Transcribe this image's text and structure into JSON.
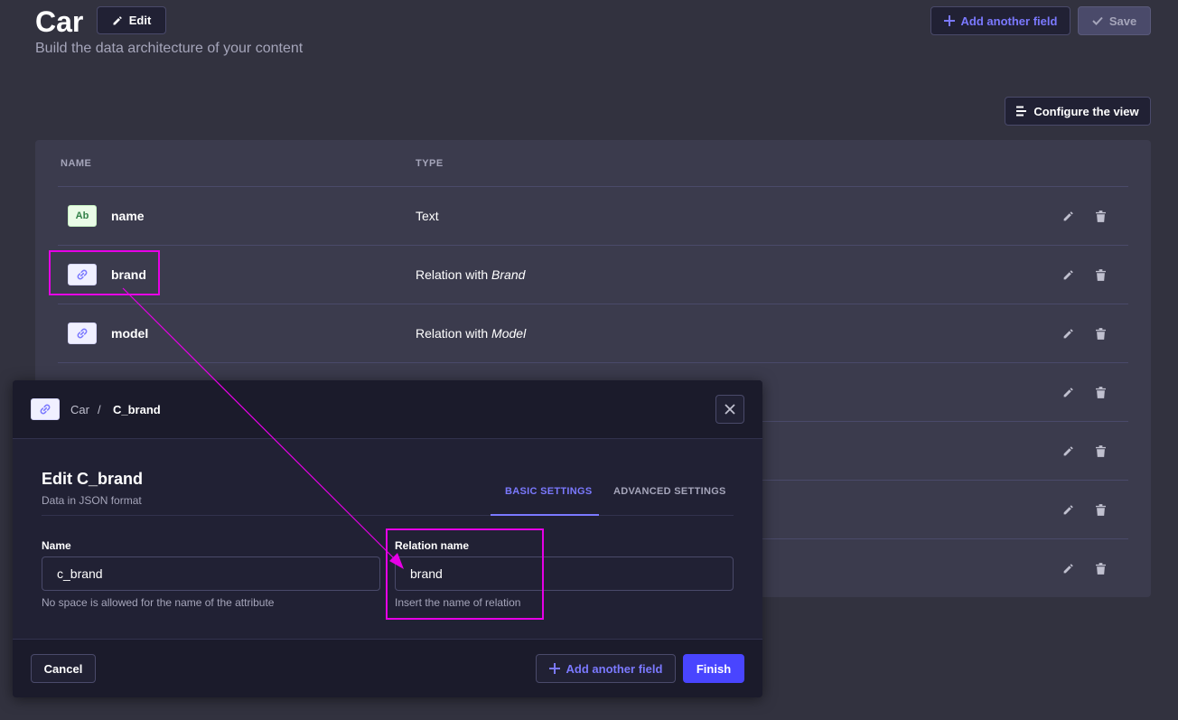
{
  "header": {
    "title": "Car",
    "subtitle": "Build the data architecture of your content",
    "edit_label": "Edit",
    "add_field_label": "Add another field",
    "save_label": "Save",
    "configure_label": "Configure the view"
  },
  "table": {
    "columns": [
      "NAME",
      "TYPE"
    ],
    "rows": [
      {
        "icon": "Ab",
        "name": "name",
        "type_prefix": "Text",
        "type_target": ""
      },
      {
        "icon": "relation",
        "name": "brand",
        "type_prefix": "Relation with",
        "type_target": "Brand"
      },
      {
        "icon": "relation",
        "name": "model",
        "type_prefix": "Relation with",
        "type_target": "Model"
      }
    ]
  },
  "modal": {
    "breadcrumb_parent": "Car",
    "breadcrumb_sep": "/",
    "breadcrumb_current": "C_brand",
    "title": "Edit C_brand",
    "subtitle": "Data in JSON format",
    "tabs": [
      "BASIC SETTINGS",
      "ADVANCED SETTINGS"
    ],
    "name_label": "Name",
    "name_value": "c_brand",
    "name_hint": "No space is allowed for the name of the attribute",
    "relation_label": "Relation name",
    "relation_value": "brand",
    "relation_hint": "Insert the name of relation",
    "cancel_label": "Cancel",
    "add_field_label": "Add another field",
    "finish_label": "Finish"
  },
  "colors": {
    "accent": "#7b79ff",
    "primary": "#4945ff",
    "annotation": "#e600e6"
  }
}
